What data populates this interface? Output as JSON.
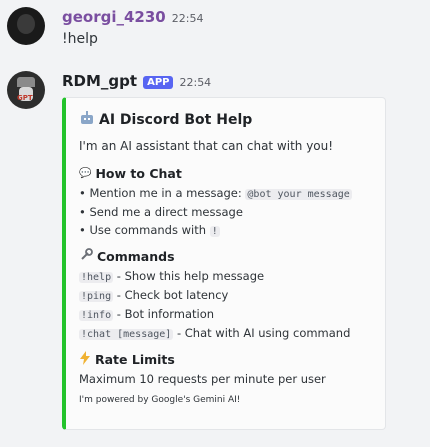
{
  "messages": [
    {
      "username": "georgi_4230",
      "time": "22:54",
      "text": "!help"
    },
    {
      "username": "RDM_gpt",
      "badge": "APP",
      "time": "22:54"
    }
  ],
  "embed": {
    "accent_color": "#23c32b",
    "title_icon": "robot-icon",
    "title": "AI Discord Bot Help",
    "description": "I'm an AI assistant that can chat with you!",
    "how_to_chat": {
      "icon": "speech-bubble-icon",
      "name": "How to Chat",
      "line1_prefix": "• Mention me in a message:",
      "line1_code": "@bot your message",
      "line2": "• Send me a direct message",
      "line3_prefix": "• Use commands with",
      "line3_code": "!"
    },
    "commands": {
      "icon": "wrench-icon",
      "name": "Commands",
      "items": [
        {
          "code": "!help",
          "desc": "- Show this help message"
        },
        {
          "code": "!ping",
          "desc": "- Check bot latency"
        },
        {
          "code": "!info",
          "desc": "- Bot information"
        },
        {
          "code": "!chat [message]",
          "desc": "- Chat with AI using command"
        }
      ]
    },
    "rate_limits": {
      "icon": "lightning-icon",
      "name": "Rate Limits",
      "value": "Maximum 10 requests per minute per user"
    },
    "footer": "I'm powered by Google's Gemini AI!"
  }
}
